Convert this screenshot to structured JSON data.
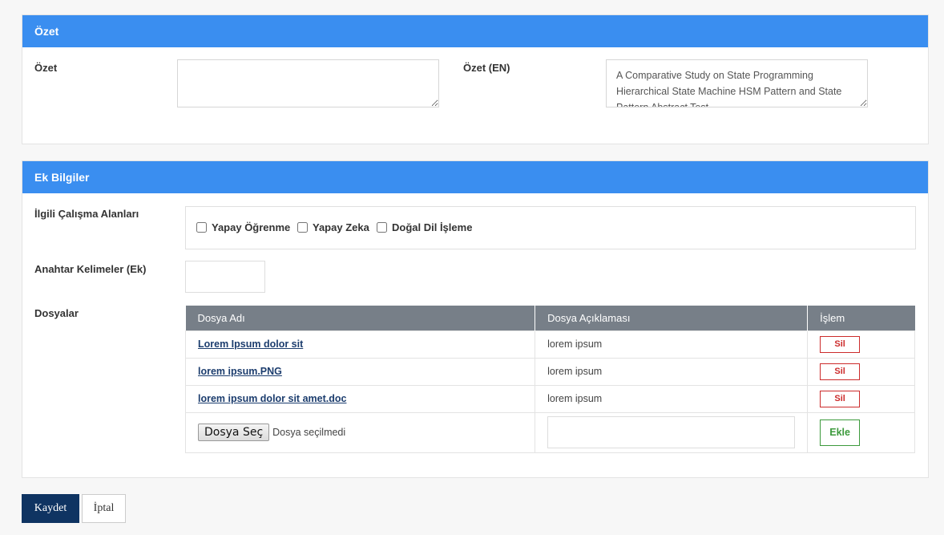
{
  "ozet_panel": {
    "title": "Özet",
    "ozet_label": "Özet",
    "ozet_value": "",
    "ozet_en_label": "Özet (EN)",
    "ozet_en_value": "A Comparative Study on State Programming Hierarchical State Machine HSM Pattern and State Pattern Abstract Test"
  },
  "ek_panel": {
    "title": "Ek Bilgiler",
    "areas_label": "İlgili Çalışma Alanları",
    "areas": [
      {
        "label": "Yapay Öğrenme",
        "checked": false
      },
      {
        "label": "Yapay Zeka",
        "checked": false
      },
      {
        "label": "Doğal Dil İşleme",
        "checked": false
      }
    ],
    "keywords_label": "Anahtar Kelimeler (Ek)",
    "keywords_value": "",
    "files_label": "Dosyalar",
    "files_table": {
      "headers": [
        "Dosya Adı",
        "Dosya Açıklaması",
        "İşlem"
      ],
      "rows": [
        {
          "name": "Lorem Ipsum dolor sit",
          "desc": "lorem ipsum",
          "action": "Sil"
        },
        {
          "name": "lorem ipsum.PNG",
          "desc": "lorem ipsum",
          "action": "Sil"
        },
        {
          "name": "lorem ipsum dolor sit amet.doc",
          "desc": "lorem ipsum",
          "action": "Sil"
        }
      ],
      "choose_file_label": "Dosya Seç",
      "no_file_text": "Dosya seçilmedi",
      "new_desc_value": "",
      "add_label": "Ekle"
    }
  },
  "footer": {
    "save_label": "Kaydet",
    "cancel_label": "İptal"
  },
  "colors": {
    "header_blue": "#3a8ef0",
    "save_navy": "#0f3462",
    "delete_red": "#cc2b2b",
    "add_green": "#3c9a3c",
    "table_header_gray": "#777f88"
  }
}
